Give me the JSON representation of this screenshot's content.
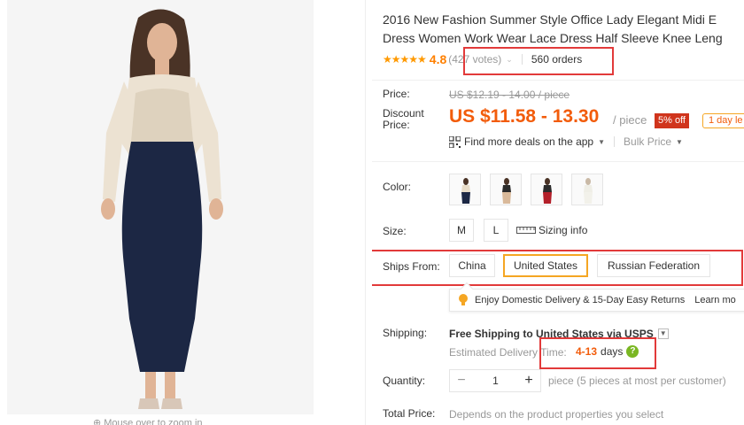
{
  "product": {
    "title_line1": "2016 New Fashion Summer Style Office Lady Elegant Midi E",
    "title_line2": "Dress Women Work Wear Lace Dress Half Sleeve Knee Leng",
    "stars": "★★★★★",
    "rating": "4.8",
    "votes": "(427 votes)",
    "orders": "560 orders"
  },
  "gallery": {
    "zoom_hint": "⊕ Mouse over to zoom in"
  },
  "pricing": {
    "price_label": "Price:",
    "old_price": "US $12.19 - 14.00 / piece",
    "discount_label": "Discount Price:",
    "discount_price": "US $11.58 - 13.30",
    "per_piece": "/ piece",
    "discount_badge": "5% off",
    "day_badge": "1 day le",
    "find_deals": "Find more deals on the app",
    "bulk_price": "Bulk Price"
  },
  "options": {
    "color_label": "Color:",
    "size_label": "Size:",
    "sizes": [
      "M",
      "L"
    ],
    "sizing_info": "Sizing info",
    "ships_from_label": "Ships From:",
    "ship_origins": [
      "China",
      "United States",
      "Russian Federation"
    ],
    "selected_origin": "United States",
    "tooltip_text": "Enjoy Domestic Delivery & 15-Day Easy Returns",
    "learn_more": "Learn mo"
  },
  "shipping": {
    "label": "Shipping:",
    "free_shipping": "Free Shipping to United States via USPS",
    "estimated_label": "Estimated Delivery Time:",
    "days_range": "4-13",
    "days_unit": "days"
  },
  "quantity": {
    "label": "Quantity:",
    "minus": "−",
    "value": "1",
    "plus": "+",
    "note": "piece (5 pieces at most per customer)"
  },
  "total": {
    "label": "Total Price:",
    "value": "Depends on the product properties you select"
  },
  "colors": {
    "accent_orange": "#f25c0b",
    "highlight_red": "#e23a3a",
    "selected_border": "#f5a623",
    "dress_navy": "#1c2744",
    "lace_cream": "#e8dcc8"
  }
}
